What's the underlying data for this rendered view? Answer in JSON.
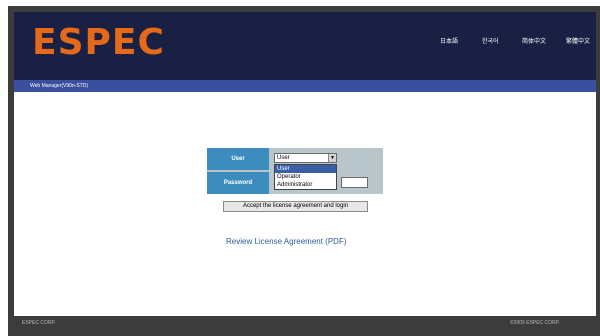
{
  "header": {
    "logo_text": "ESPEC",
    "languages": [
      "日本語",
      "한국어",
      "简体中文",
      "繁體中文"
    ]
  },
  "subbar": {
    "title": "Web Manager(V90n-STD)"
  },
  "login": {
    "user_label": "User",
    "password_label": "Password",
    "select_value": "User",
    "options": [
      "User",
      "Operator",
      "Administrator"
    ],
    "accept_button": "Accept the license agreement and login",
    "review_link": "Review License Agreement (PDF)"
  },
  "footer": {
    "left": "ESPEC CORP.",
    "right": "©2009 ESPEC CORP."
  },
  "colors": {
    "header_bg": "#1a1f44",
    "logo": "#e46a1a",
    "subbar_bg": "#3a4f9e",
    "label_cell": "#3c8dbd",
    "link": "#2d5e9a"
  }
}
